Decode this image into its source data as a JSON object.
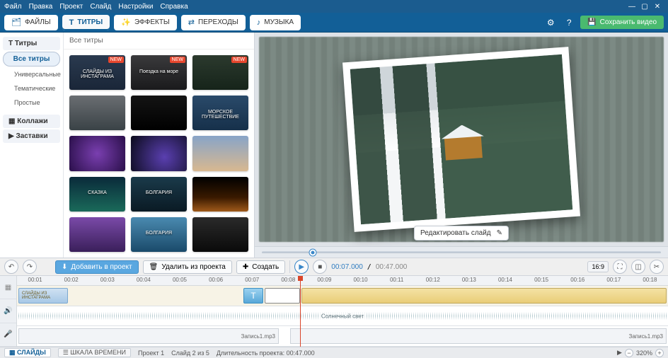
{
  "menu": {
    "items": [
      "Файл",
      "Правка",
      "Проект",
      "Слайд",
      "Настройки",
      "Справка"
    ]
  },
  "window": {
    "minimize": "—",
    "maximize": "▢",
    "close": "✕"
  },
  "tabs": [
    {
      "icon": "🗂",
      "label": "ФАЙЛЫ"
    },
    {
      "icon": "T",
      "label": "ТИТРЫ"
    },
    {
      "icon": "✨",
      "label": "ЭФФЕКТЫ"
    },
    {
      "icon": "⇄",
      "label": "ПЕРЕХОДЫ"
    },
    {
      "icon": "♪",
      "label": "МУЗЫКА"
    }
  ],
  "toolbar": {
    "settings_icon": "⚙",
    "help_icon": "?",
    "save_label": "Сохранить видео",
    "save_icon": "💾"
  },
  "side": {
    "titles": "Титры",
    "all": "Все титры",
    "universal": "Универсальные",
    "thematic": "Тематические",
    "simple": "Простые",
    "collages": "Коллажи",
    "splash": "Заставки"
  },
  "catalog": {
    "heading": "Все титры",
    "new_badge": "NEW",
    "thumbs": [
      {
        "cap": "СЛАЙДЫ ИЗ ИНСТАГРАМА",
        "bg": "linear-gradient(#2a3a4f,#1a2638)",
        "new": true
      },
      {
        "cap": "Поездка на море",
        "bg": "linear-gradient(#3a3a3c,#1a1a1c)",
        "new": true
      },
      {
        "cap": "",
        "bg": "linear-gradient(#2c3a2e,#16241a)",
        "new": true
      },
      {
        "cap": "",
        "bg": "linear-gradient(#6a6e72,#3a4246)",
        "new": false
      },
      {
        "cap": "",
        "bg": "linear-gradient(#141414,#000)",
        "new": false
      },
      {
        "cap": "МОРСКОЕ ПУТЕШЕСТВИЕ",
        "bg": "linear-gradient(#2a4a6a,#16304a)",
        "new": false
      },
      {
        "cap": "",
        "bg": "radial-gradient(circle at 50% 50%, #7a3fb0, #2a0f4a)",
        "new": false
      },
      {
        "cap": "",
        "bg": "radial-gradient(circle at 60% 60%, #5a3fb0, #0a0a1a)",
        "new": false
      },
      {
        "cap": "",
        "bg": "linear-gradient(#88a4c8,#d8b890)",
        "new": false
      },
      {
        "cap": "СКАЗКА",
        "bg": "linear-gradient(#0a2a3a, #1a6a5a)",
        "new": false
      },
      {
        "cap": "БОЛГАРИЯ",
        "bg": "linear-gradient(#1a3a4a,#0a1a24)",
        "new": false
      },
      {
        "cap": "",
        "bg": "linear-gradient(#000,#3a1a00 60%, #a05a1a)",
        "new": false
      },
      {
        "cap": "",
        "bg": "linear-gradient(#7a4aa8,#3a1f5a)",
        "new": false
      },
      {
        "cap": "БОЛГАРИЯ",
        "bg": "linear-gradient(#4a8ab0,#1a4a6a)",
        "new": false
      },
      {
        "cap": "",
        "bg": "linear-gradient(#2a2a2a,#0a0a0a)",
        "new": false
      }
    ]
  },
  "preview": {
    "edit_label": "Редактировать слайд",
    "edit_icon": "✎"
  },
  "transport": {
    "undo": "↶",
    "redo": "↷",
    "add_label": "Добавить в проект",
    "add_icon": "⬇",
    "remove_label": "Удалить из проекта",
    "remove_icon": "🗑",
    "create_label": "Создать",
    "create_icon": "✚",
    "play": "▶",
    "stop": "■",
    "time_current": "00:07.000",
    "time_total": "00:47.000",
    "ratio": "16:9",
    "full_icon": "⛶",
    "snap_icon": "◫",
    "split_icon": "✂"
  },
  "ruler": [
    "00:01",
    "00:02",
    "00:03",
    "00:04",
    "00:05",
    "00:06",
    "00:07",
    "00:08",
    "00:09",
    "00:10",
    "00:11",
    "00:12",
    "00:13",
    "00:14",
    "00:15",
    "00:16",
    "00:17",
    "00:18"
  ],
  "tracks": {
    "video_icon": "▦",
    "audio_icon": "🔊",
    "mic_icon": "🎤",
    "intro_text": "СЛАЙДЫ ИЗ ИНСТАГРАМА",
    "audio_label": "Солнечный свет",
    "mic_label": "Запись1.mp3"
  },
  "status": {
    "tab_slides": "СЛАЙДЫ",
    "tab_timeline": "ШКАЛА ВРЕМЕНИ",
    "project": "Проект 1",
    "slide_info": "Слайд 2 из 5",
    "duration": "Длительность проекта: 00:47.000",
    "zoom": "320%",
    "play": "▶",
    "minus": "−",
    "plus": "+"
  }
}
